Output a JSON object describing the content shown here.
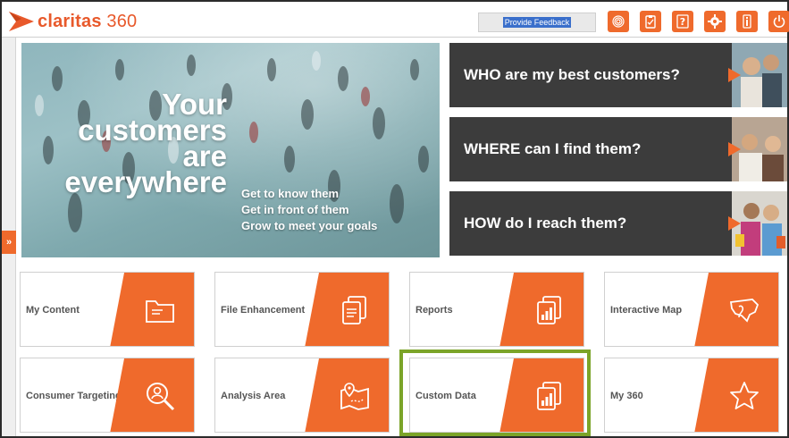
{
  "header": {
    "logo_text_prefix": "claritas",
    "logo_text_suffix": " 360",
    "feedback_label": "Provide Feedback",
    "icons": [
      "fingerprint-icon",
      "clipboard-icon",
      "help-icon",
      "gear-icon",
      "info-icon",
      "power-icon"
    ]
  },
  "rail": {
    "toggle_label": "»"
  },
  "hero": {
    "headline": [
      "Your",
      "customers",
      "are",
      "everywhere"
    ],
    "subs": [
      "Get to know them",
      "Get in front of them",
      "Grow to meet your goals"
    ]
  },
  "questions": [
    {
      "text": "WHO are my best customers?"
    },
    {
      "text": "WHERE can I find them?"
    },
    {
      "text": "HOW do I reach them?"
    }
  ],
  "tiles": [
    {
      "label": "My Content",
      "icon": "folder-icon"
    },
    {
      "label": "File Enhancement",
      "icon": "documents-icon"
    },
    {
      "label": "Reports",
      "icon": "report-chart-icon"
    },
    {
      "label": "Interactive Map",
      "icon": "usa-map-icon"
    },
    {
      "label": "Consumer Targeting",
      "icon": "magnify-person-icon"
    },
    {
      "label": "Analysis Area",
      "icon": "map-pin-icon"
    },
    {
      "label": "Custom Data",
      "icon": "report-chart-icon"
    },
    {
      "label": "My 360",
      "icon": "star-icon"
    }
  ],
  "colors": {
    "brand_orange": "#ef6a2c",
    "panel_dark": "#3c3c3c",
    "highlight_green": "#7ba428"
  }
}
